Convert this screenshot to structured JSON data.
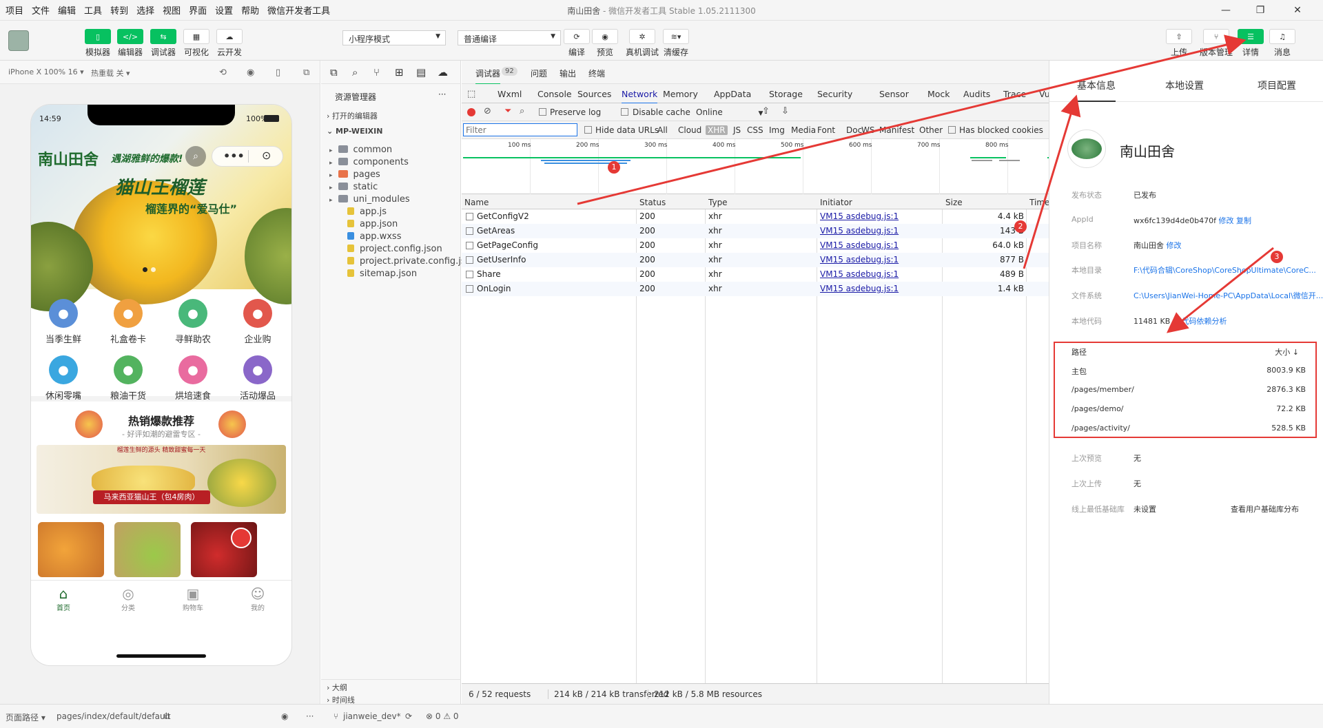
{
  "menubar": {
    "items": [
      "项目",
      "文件",
      "编辑",
      "工具",
      "转到",
      "选择",
      "视图",
      "界面",
      "设置",
      "帮助",
      "微信开发者工具"
    ],
    "title_app": "南山田舍",
    "title_rest": " - 微信开发者工具 Stable 1.05.2111300"
  },
  "toolbar": {
    "simulator": "模拟器",
    "editor": "编辑器",
    "debugger": "调试器",
    "visual": "可视化",
    "cloud": "云开发",
    "mode_select": "小程序模式",
    "compile_select": "普通编译",
    "compile": "编译",
    "preview": "预览",
    "real_debug": "真机调试",
    "clear_cache": "清缓存",
    "upload": "上传",
    "version": "版本管理",
    "details": "详情",
    "messages": "消息"
  },
  "simulator": {
    "device": "iPhone X 100% 16 ▾",
    "hot_reload": "热重载 关 ▾",
    "time": "14:59",
    "battery": "100%",
    "brand": "南山田舍",
    "slogan": "遇湖雅鲜的爆款!",
    "banner_title": "猫山王榴莲",
    "banner_sub": "榴莲界的“爱马仕”",
    "categories": [
      {
        "label": "当季生鲜",
        "color": "#5b8fd8"
      },
      {
        "label": "礼盒卷卡",
        "color": "#f0a040"
      },
      {
        "label": "寻鲜助农",
        "color": "#49b87a"
      },
      {
        "label": "企业购",
        "color": "#e2574c"
      },
      {
        "label": "休闲零嘴",
        "color": "#3aa7e0"
      },
      {
        "label": "粮油干货",
        "color": "#53b35f"
      },
      {
        "label": "烘培速食",
        "color": "#e96b9f"
      },
      {
        "label": "活动爆品",
        "color": "#8a67c9"
      }
    ],
    "hot_title": "热销爆款推荐",
    "hot_sub": "- 好评如潮的避雷专区 -",
    "promo_top": "榴莲生鲜的源头 精致甜蜜每一天",
    "promo_text": "马来西亚猫山王（包4房肉）",
    "tabbar": [
      "首页",
      "分类",
      "购物车",
      "我的"
    ]
  },
  "explorer": {
    "title": "资源管理器",
    "more": "···",
    "open_editors": "打开的编辑器",
    "root": "MP-WEIXIN",
    "items": [
      {
        "name": "common",
        "color": "#8a8f99"
      },
      {
        "name": "components",
        "color": "#8a8f99"
      },
      {
        "name": "pages",
        "color": "#e8734a"
      },
      {
        "name": "static",
        "color": "#8a8f99"
      },
      {
        "name": "uni_modules",
        "color": "#8a8f99"
      },
      {
        "name": "app.js",
        "color": "#e6c33a"
      },
      {
        "name": "app.json",
        "color": "#e6c33a"
      },
      {
        "name": "app.wxss",
        "color": "#3a8fe0"
      },
      {
        "name": "project.config.json",
        "color": "#e6c33a"
      },
      {
        "name": "project.private.config.js...",
        "color": "#e6c33a"
      },
      {
        "name": "sitemap.json",
        "color": "#e6c33a"
      }
    ],
    "outline": "大纲",
    "timeline": "时间线"
  },
  "devtools": {
    "debugger_label": "调试器",
    "debugger_count": "92",
    "issues": "问题",
    "output": "输出",
    "terminal": "终端",
    "tabs": [
      "Wxml",
      "Console",
      "Sources",
      "Network",
      "Memory",
      "AppData",
      "Storage",
      "Security",
      "Sensor",
      "Mock",
      "Audits",
      "Trace",
      "Vulnerab"
    ],
    "preserve_log": "Preserve log",
    "disable_cache": "Disable cache",
    "online": "Online",
    "filter_placeholder": "Filter",
    "hide_data_urls": "Hide data URLs",
    "filter_types": [
      "All",
      "Cloud",
      "XHR",
      "JS",
      "CSS",
      "Img",
      "Media",
      "Font",
      "Doc",
      "WS",
      "Manifest",
      "Other"
    ],
    "has_blocked": "Has blocked cookies",
    "ticks": [
      "100 ms",
      "200 ms",
      "300 ms",
      "400 ms",
      "500 ms",
      "600 ms",
      "700 ms",
      "800 ms"
    ],
    "columns": [
      "Name",
      "Status",
      "Type",
      "Initiator",
      "Size",
      "Time"
    ],
    "rows": [
      {
        "name": "GetConfigV2",
        "status": "200",
        "type": "xhr",
        "initiator": "VM15 asdebug.js:1",
        "size": "4.4 kB"
      },
      {
        "name": "GetAreas",
        "status": "200",
        "type": "xhr",
        "initiator": "VM15 asdebug.js:1",
        "size": "143 B"
      },
      {
        "name": "GetPageConfig",
        "status": "200",
        "type": "xhr",
        "initiator": "VM15 asdebug.js:1",
        "size": "64.0 kB"
      },
      {
        "name": "GetUserInfo",
        "status": "200",
        "type": "xhr",
        "initiator": "VM15 asdebug.js:1",
        "size": "877 B"
      },
      {
        "name": "Share",
        "status": "200",
        "type": "xhr",
        "initiator": "VM15 asdebug.js:1",
        "size": "489 B"
      },
      {
        "name": "OnLogin",
        "status": "200",
        "type": "xhr",
        "initiator": "VM15 asdebug.js:1",
        "size": "1.4 kB"
      }
    ],
    "status_requests": "6 / 52 requests",
    "status_transferred": "214 kB / 214 kB transferred",
    "status_resources": "212 kB / 5.8 MB resources"
  },
  "details": {
    "tabs": [
      "基本信息",
      "本地设置",
      "项目配置"
    ],
    "project_name": "南山田舍",
    "labels": {
      "publish": "发布状态",
      "appid": "AppId",
      "name": "项目名称",
      "dir": "本地目录",
      "fs": "文件系统",
      "code": "本地代码",
      "last_preview": "上次预览",
      "last_upload": "上次上传",
      "min_lib": "线上最低基础库"
    },
    "publish_status": "已发布",
    "appid": "wx6fc139d4de0b470f",
    "modify": "修改",
    "copy": "复制",
    "name_value": "南山田舍",
    "dir_value": "F:\\代码合辑\\CoreShop\\CoreShopUltimate\\CoreC...",
    "fs_value": "C:\\Users\\JianWei-Home-PC\\AppData\\Local\\微信开...",
    "code_size": "11481 KB",
    "code_caret": "^",
    "dep_analysis": "代码依赖分析",
    "pkg_head_path": "路径",
    "pkg_head_size": "大小 ↓",
    "packages": [
      {
        "path": "主包",
        "size": "8003.9 KB"
      },
      {
        "path": "/pages/member/",
        "size": "2876.3 KB"
      },
      {
        "path": "/pages/demo/",
        "size": "72.2 KB"
      },
      {
        "path": "/pages/activity/",
        "size": "528.5 KB"
      }
    ],
    "none": "无",
    "not_set": "未设置",
    "lib_dist": "查看用户基础库分布"
  },
  "annotations": [
    "1",
    "2",
    "3"
  ],
  "statusbar": {
    "page_path_label": "页面路径 ▾",
    "page_path": "pages/index/default/default",
    "branch": "jianweie_dev*",
    "errors": "⊗ 0 ⚠ 0"
  },
  "colors": {
    "accent": "#07c160",
    "arrow": "#e53935",
    "link": "#1a73e8"
  }
}
